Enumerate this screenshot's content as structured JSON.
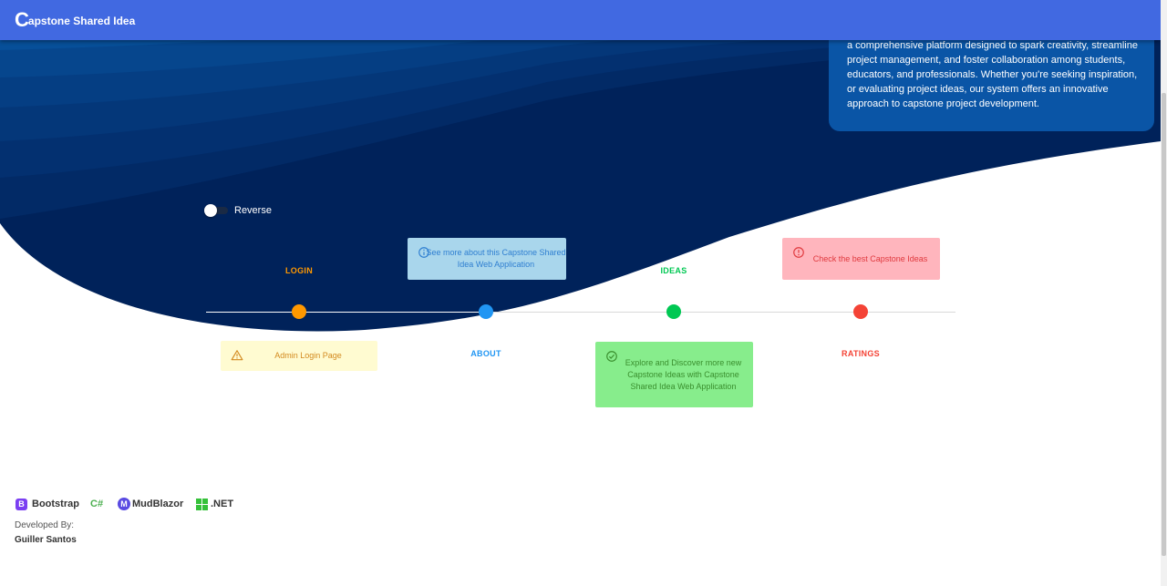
{
  "app": {
    "title": "Capstone Shared Idea",
    "logo_initial": "C",
    "logo_rest": "apstone Shared Idea"
  },
  "about": {
    "text": "a comprehensive platform designed to spark creativity, streamline project management, and foster collaboration among students, educators, and professionals. Whether you're seeking inspiration, or evaluating project ideas, our system offers an innovative approach to capstone project development."
  },
  "switch": {
    "label": "Reverse",
    "checked": false
  },
  "timeline": [
    {
      "label": "LOGIN",
      "color": "#ff9800",
      "card_text": "Admin Login Page",
      "card_icon": "warning-icon",
      "card_bg": "#fffbd1",
      "card_color": "#d38a1f"
    },
    {
      "label": "ABOUT",
      "color": "#2196f3",
      "card_text": "See more about this Capstone Shared Idea Web Application",
      "card_icon": "info-icon",
      "card_bg": "#a9d6ec",
      "card_color": "#2f7fd1"
    },
    {
      "label": "IDEAS",
      "color": "#00c853",
      "card_text": "Explore and Discover more new Capstone Ideas with Capstone Shared Idea Web Application",
      "card_icon": "check-circle-icon",
      "card_bg": "#87ed8c",
      "card_color": "#3a8f2e"
    },
    {
      "label": "RATINGS",
      "color": "#f44336",
      "card_text": "Check the best Capstone Ideas",
      "card_icon": "error-icon",
      "card_bg": "#ffb5bd",
      "card_color": "#e0393e"
    }
  ],
  "tech": {
    "bootstrap": "Bootstrap",
    "bootstrap_icon": "B",
    "csharp": "C#",
    "mudblazor": "MudBlazor",
    "mudblazor_icon": "M",
    "dotnet": ".NET"
  },
  "footer": {
    "developed_by": "Developed By:",
    "developer": "Guiller Santos"
  },
  "colors": {
    "appbar": "#4169e1",
    "wave_dark": "#00225a",
    "accent_white": "#ffffff"
  }
}
